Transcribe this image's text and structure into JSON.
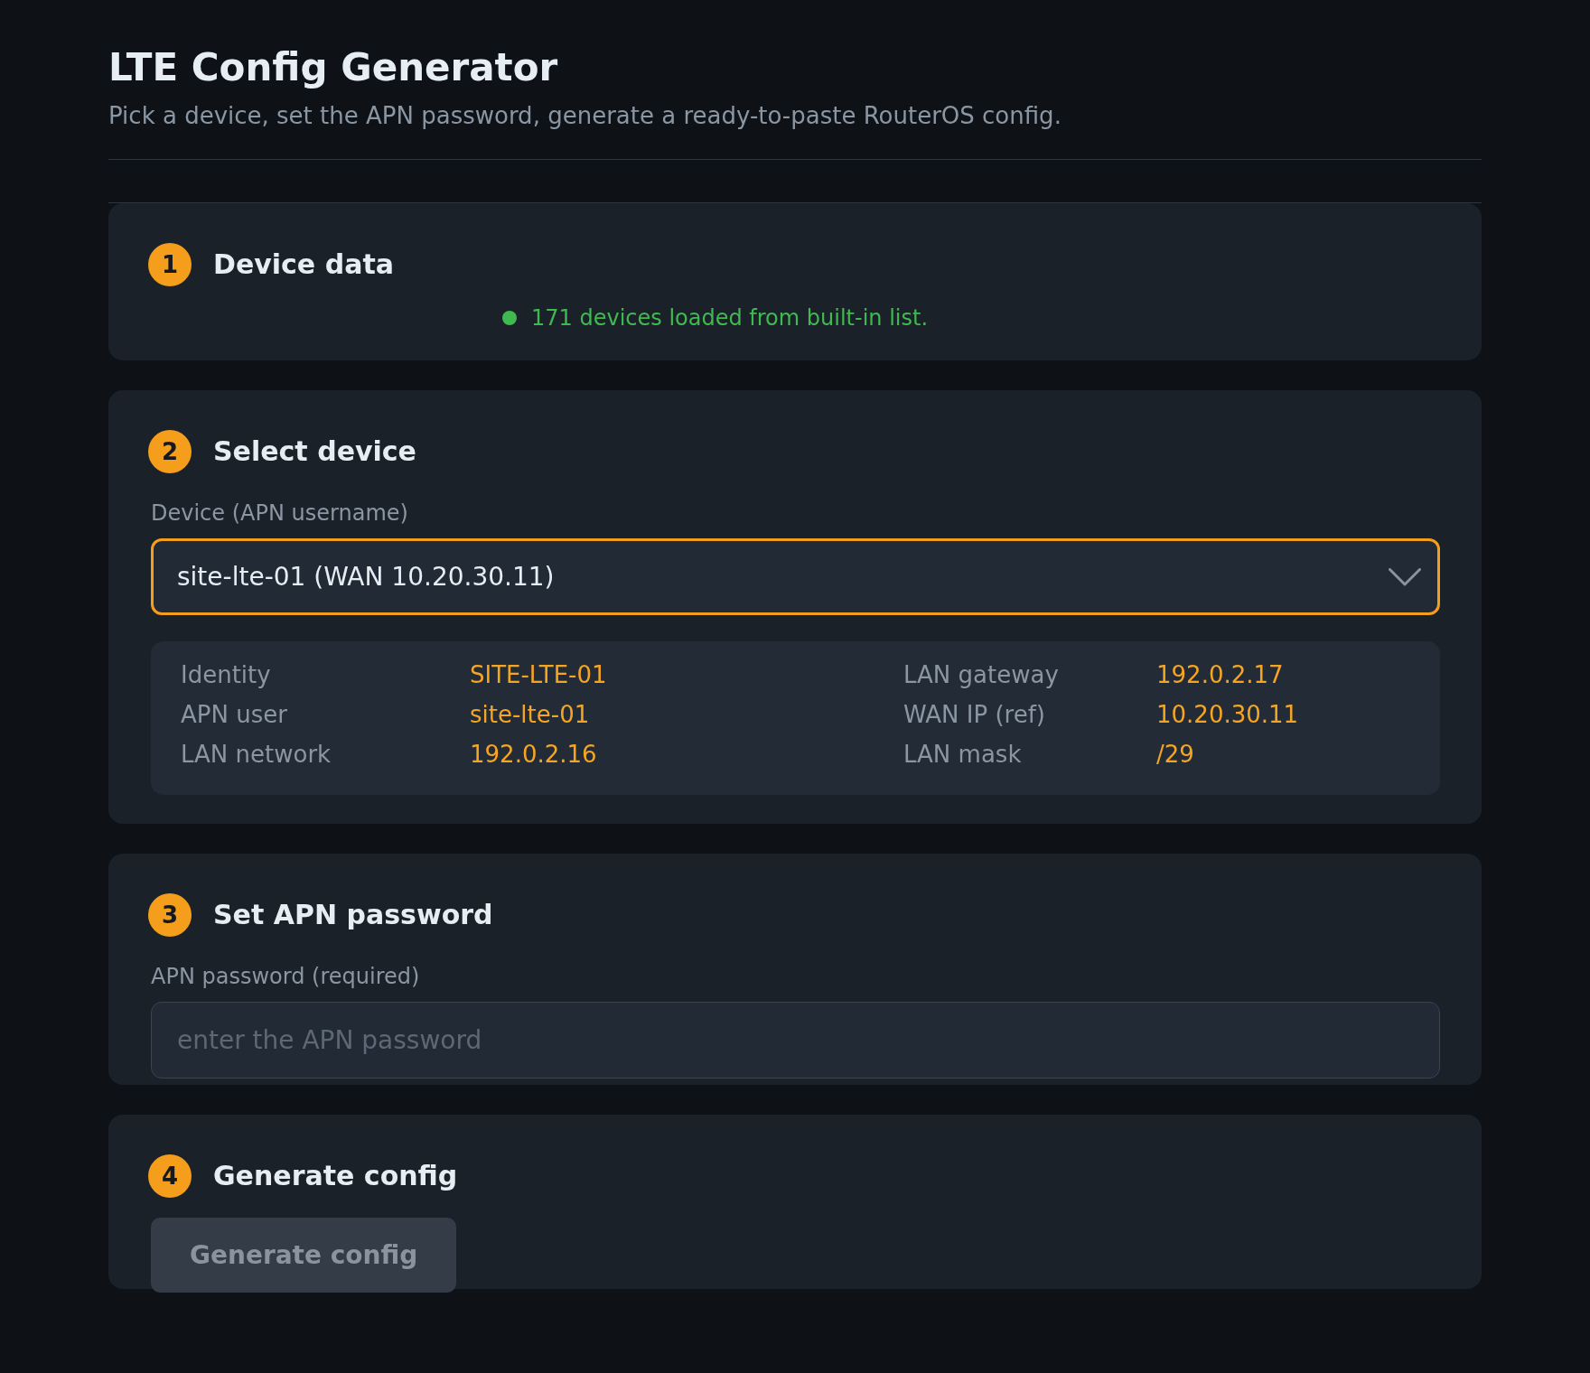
{
  "header": {
    "title": "LTE Config Generator",
    "subtitle": "Pick a device, set the APN password, generate a ready-to-paste RouterOS config."
  },
  "steps": [
    {
      "number": "1",
      "title": "Device data",
      "kind": "status",
      "status": {
        "ok": true,
        "text": "171 devices loaded from built-in list."
      }
    },
    {
      "number": "2",
      "title": "Select device",
      "kind": "select",
      "select": {
        "label": "Device (APN username)",
        "value": "site-lte-01 (WAN 10.20.30.11)",
        "focused": true
      },
      "details": [
        {
          "label": "Identity",
          "value": "SITE-LTE-01"
        },
        {
          "label": "LAN gateway",
          "value": "192.0.2.17"
        },
        {
          "label": "APN user",
          "value": "site-lte-01"
        },
        {
          "label": "WAN IP (ref)",
          "value": "10.20.30.11"
        },
        {
          "label": "LAN network",
          "value": "192.0.2.16"
        },
        {
          "label": "LAN mask",
          "value": "/29"
        }
      ]
    },
    {
      "number": "3",
      "title": "Set APN password",
      "kind": "input",
      "field": {
        "label": "APN password (required)",
        "placeholder": "enter the APN password"
      }
    },
    {
      "number": "4",
      "title": "Generate config",
      "kind": "button",
      "button": {
        "label": "Generate config",
        "disabled": true
      }
    }
  ]
}
